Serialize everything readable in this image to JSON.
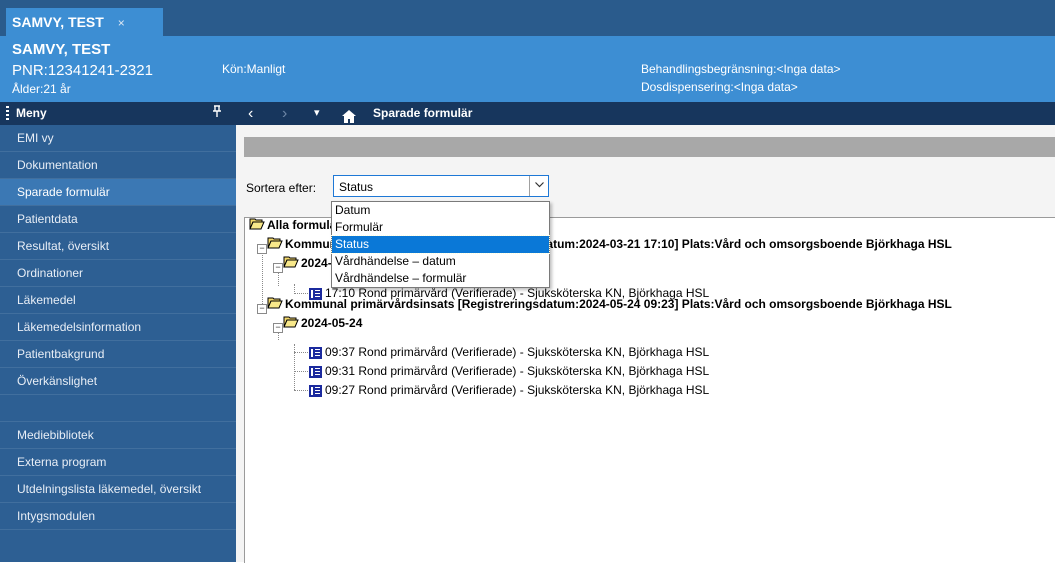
{
  "window": {
    "tab_title": "SAMVY, TEST",
    "tab_close": "×"
  },
  "patient": {
    "name": "SAMVY, TEST",
    "pnr": "PNR:12341241-2321",
    "age": "Ålder:21 år",
    "gender": "Kön:Manligt",
    "treatment_limit": "Behandlingsbegränsning:<Inga data>",
    "dose_dispensing": "Dosdispensering:<Inga data>"
  },
  "menu": {
    "header": "Meny",
    "pin": "⊥",
    "items_top": [
      {
        "label": "EMI vy"
      },
      {
        "label": "Dokumentation"
      },
      {
        "label": "Sparade formulär",
        "active": true
      },
      {
        "label": "Patientdata"
      },
      {
        "label": "Resultat, översikt"
      },
      {
        "label": "Ordinationer"
      },
      {
        "label": "Läkemedel"
      },
      {
        "label": "Läkemedelsinformation"
      },
      {
        "label": "Patientbakgrund"
      },
      {
        "label": "Överkänslighet"
      }
    ],
    "items_bottom": [
      {
        "label": "Mediebibliotek"
      },
      {
        "label": "Externa program"
      },
      {
        "label": "Utdelningslista läkemedel, översikt"
      },
      {
        "label": "Intygsmodulen"
      }
    ]
  },
  "nav": {
    "back": "‹",
    "forward": "›",
    "dropdown": "▾",
    "home": "⌂",
    "title": "Sparade formulär"
  },
  "sort": {
    "label": "Sortera efter:",
    "value": "Status",
    "arrow": "⌄",
    "options": [
      "Datum",
      "Formulär",
      "Status",
      "Vårdhändelse – datum",
      "Vårdhändelse – formulär"
    ],
    "selected": "Status"
  },
  "tree": {
    "root": "Alla formulär",
    "group1": {
      "label": "Kommunal primärvårdsinsats [Registreringsdatum:2024-03-21 17:10] Plats:Vård och omsorgsboende Björkhaga HSL",
      "date": "2024-03-21",
      "entry": "17:10  Rond primärvård (Verifierade) - Sjuksköterska KN, Björkhaga HSL"
    },
    "group2": {
      "label": "Kommunal primärvårdsinsats [Registreringsdatum:2024-05-24 09:23] Plats:Vård och omsorgsboende Björkhaga HSL",
      "date": "2024-05-24",
      "entries": [
        "09:37  Rond primärvård (Verifierade) - Sjuksköterska KN, Björkhaga HSL",
        "09:31  Rond primärvård (Verifierade) - Sjuksköterska KN, Björkhaga HSL",
        "09:27  Rond primärvård (Verifierade) - Sjuksköterska KN, Björkhaga HSL"
      ]
    }
  }
}
